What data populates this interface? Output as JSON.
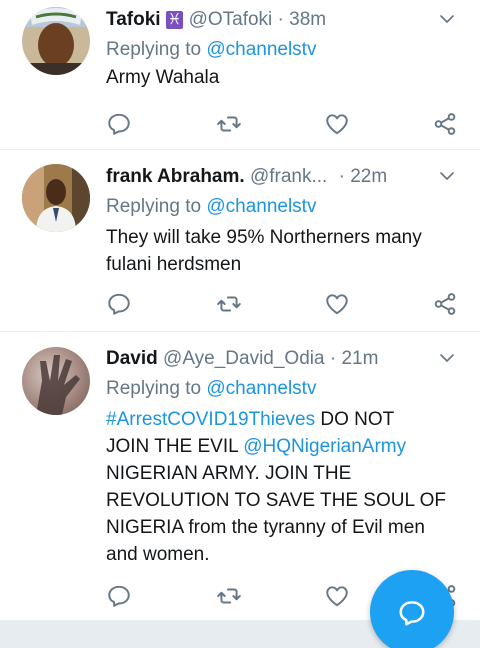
{
  "tweets": [
    {
      "name": "Tafoki",
      "name_emoji": "♓",
      "handle": "@OTafoki",
      "separator": "·",
      "time": "38m",
      "replying_prefix": "Replying to",
      "replying_handle": "@channelstv",
      "text": "Army Wahala"
    },
    {
      "name": "frank Abraham.",
      "handle": "@frank...",
      "separator": "·",
      "time": "22m",
      "replying_prefix": "Replying to",
      "replying_handle": "@channelstv",
      "text_line1": "They will take 95% Northerners many",
      "text_line2": "fulani herdsmen"
    },
    {
      "name": "David",
      "handle": "@Aye_David_Odia",
      "separator": "·",
      "time": "21m",
      "replying_prefix": "Replying to",
      "replying_handle": "@channelstv",
      "hashtag": "#ArrestCOVID19Thieves",
      "text_part1": "DO NOT",
      "text_part2": "JOIN THE EVIL",
      "mention": "@HQNigerianArmy",
      "text_line3": "NIGERIAN ARMY. JOIN THE",
      "text_line4": "REVOLUTION TO SAVE THE SOUL OF",
      "text_line5": "NIGERIA from the tyranny of Evil men",
      "text_line6": "and women."
    }
  ],
  "colors": {
    "accent": "#1da1f2",
    "link": "#1b95e0",
    "muted": "#657786",
    "border": "#e6ecf0"
  },
  "icons": [
    "reply-icon",
    "retweet-icon",
    "like-icon",
    "share-icon",
    "chevron-down-icon",
    "compose-icon"
  ]
}
